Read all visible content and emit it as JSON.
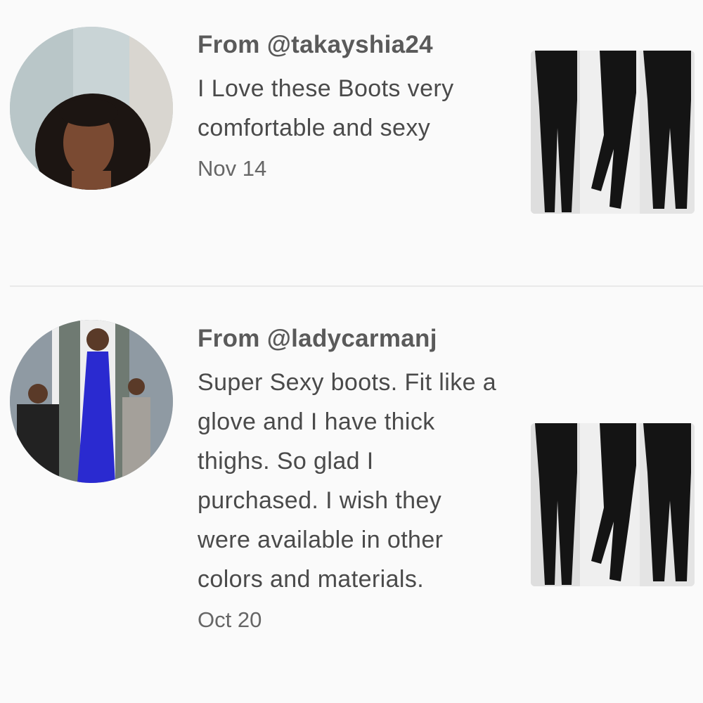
{
  "reviews": [
    {
      "author": "From @takayshia24",
      "text": "I Love these Boots very comfortable and sexy",
      "date": "Nov 14",
      "avatar_icon": "reviewer-photo",
      "thumbnail_icon": "product-photo-black-thigh-high-boots"
    },
    {
      "author": "From @ladycarmanj",
      "text": "Super Sexy boots. Fit like a glove and I have thick thighs. So glad I purchased. I wish they were available in other colors and materials.",
      "date": "Oct 20",
      "avatar_icon": "reviewer-photo",
      "thumbnail_icon": "product-photo-black-thigh-high-boots"
    }
  ],
  "colors": {
    "background": "#fafafa",
    "author": "#5a5a5a",
    "text": "#4a4a4a",
    "date": "#666666",
    "divider": "#e9e9e9"
  }
}
